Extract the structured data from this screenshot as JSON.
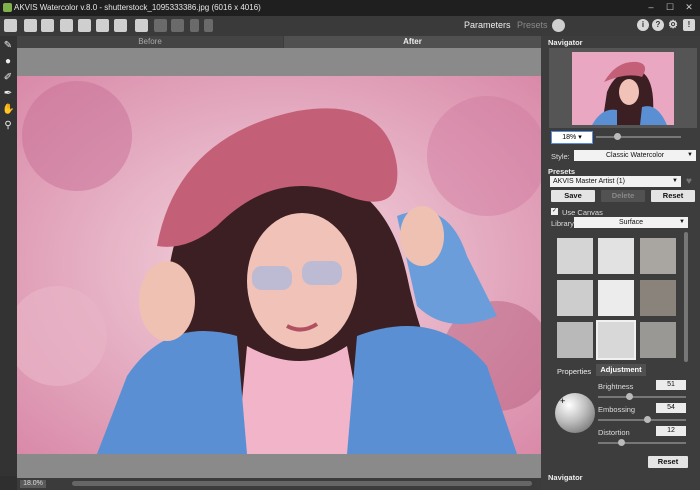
{
  "window": {
    "title": "AKVIS Watercolor v.8.0 - shutterstock_1095333386.jpg (6016 x 4016)",
    "controls": [
      "–",
      "☐",
      "✕"
    ]
  },
  "toolbar": {
    "parameters_label": "Parameters",
    "presets_label": "Presets",
    "right_icons": [
      "i",
      "?",
      "⚙",
      "!"
    ]
  },
  "tabs": {
    "before": "Before",
    "after": "After"
  },
  "status": {
    "zoom": "18.0%"
  },
  "navigator": {
    "title": "Navigator",
    "zoom": "18%",
    "zoom_caret": "▾"
  },
  "style": {
    "label": "Style:",
    "value": "Classic Watercolor"
  },
  "presets": {
    "title": "Presets",
    "value": "AKVIS Master Artist (1)",
    "save": "Save",
    "delete": "Delete",
    "reset": "Reset"
  },
  "canvas_panel": {
    "use_canvas": "Use Canvas",
    "library_label": "Library",
    "library_value": "Surface",
    "tabs": [
      "Properties",
      "Adjustment"
    ],
    "brightness_label": "Brightness",
    "brightness": "51",
    "embossing_label": "Embossing",
    "embossing": "54",
    "distortion_label": "Distortion",
    "distortion": "12",
    "reset": "Reset"
  },
  "bottom_navigator": "Navigator",
  "colors": {
    "accent": "#5a8ee0",
    "panel": "#3d3d3d",
    "canvas_gray": "#8a8a8a"
  }
}
